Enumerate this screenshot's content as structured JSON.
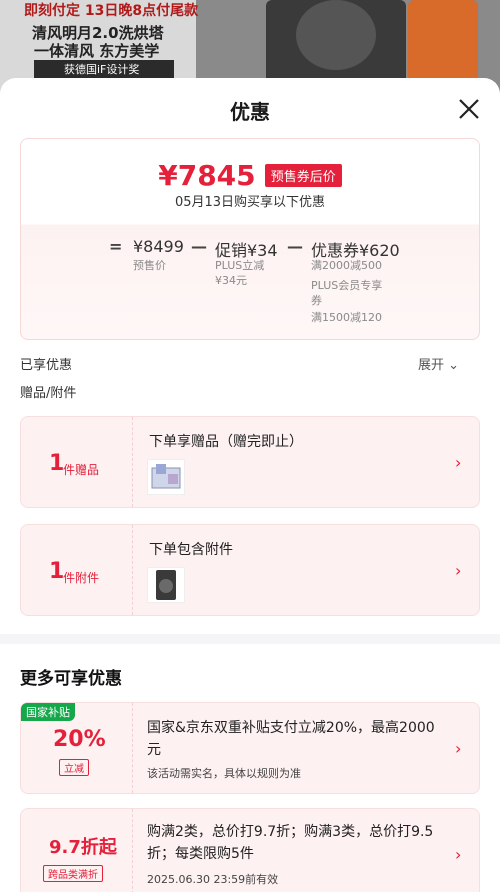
{
  "background": {
    "line1": "即刻付定 13日晚8点付尾款",
    "line2": "清风明月2.0洗烘塔",
    "line3": "一体清风 东方美学",
    "line4": "获德国iF设计奖"
  },
  "sheet": {
    "title": "优惠",
    "close_icon": "close-icon"
  },
  "summary": {
    "final_price": "¥7845",
    "final_tag": "预售券后价",
    "final_sub": "05月13日购买享以下优惠",
    "eq": "=",
    "minus1": "—",
    "minus2": "—",
    "presale_price": "¥8499",
    "presale_label": "预售价",
    "promo_value": "促销¥34",
    "promo_sub1": "PLUS立减",
    "promo_sub2": "¥34元",
    "coupon_value": "优惠券¥620",
    "coupon_sub1": "满2000减500",
    "coupon_sub2": "PLUS会员专享",
    "coupon_sub3": "券",
    "coupon_sub4": "满1500减120"
  },
  "enjoyed": {
    "label": "已享优惠",
    "expand": "展开 ⌄",
    "gift_section": "赠品/附件"
  },
  "gifts": [
    {
      "num": "1",
      "unit": "件赠品",
      "title": "下单享赠品（赠完即止）"
    },
    {
      "num": "1",
      "unit": "件附件",
      "title": "下单包含附件"
    }
  ],
  "more": {
    "title": "更多可享优惠"
  },
  "promos": [
    {
      "badge": "国家补贴",
      "big": "20%",
      "tag": "立减",
      "text": "国家&京东双重补贴支付立减20%，最高2000元",
      "note": "该活动需实名，具体以规则为准"
    },
    {
      "big": "9.7折起",
      "tag": "跨品类满折",
      "text": "购满2类，总价打9.7折；购满3类，总价打9.5折；每类限购5件",
      "note": "2025.06.30 23:59前有效"
    }
  ],
  "colors": {
    "accent": "#e4203a",
    "green_badge": "#14a84a"
  }
}
